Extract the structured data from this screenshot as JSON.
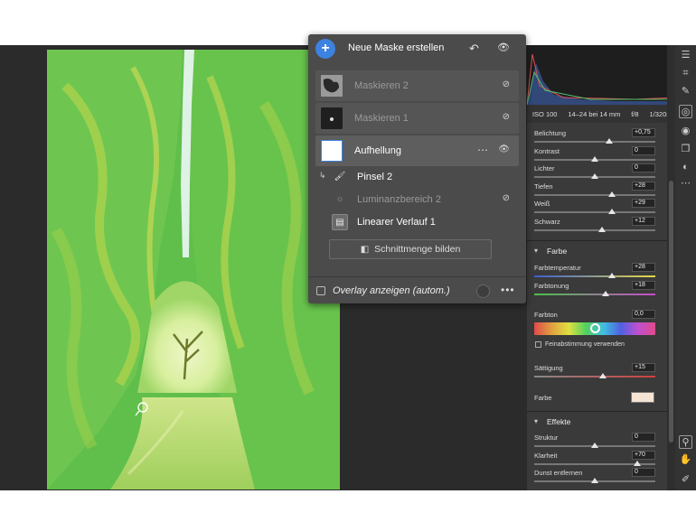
{
  "mask_panel": {
    "create_label": "Neue Maske erstellen",
    "masks": [
      {
        "label": "Maskieren 2",
        "hidden": true
      },
      {
        "label": "Maskieren 1",
        "hidden": true
      },
      {
        "label": "Aufhellung",
        "active": true
      }
    ],
    "components": [
      {
        "label": "Pinsel 2",
        "dimmed": false
      },
      {
        "label": "Luminanzbereich 2",
        "dimmed": true
      },
      {
        "label": "Linearer Verlauf 1",
        "dimmed": false
      }
    ],
    "intersect_label": "Schnittmenge bilden",
    "overlay_label": "Overlay anzeigen (autom.)"
  },
  "camera": {
    "iso": "ISO 100",
    "lens": "14–24 bei 14 mm",
    "aperture": "f/8",
    "shutter": "1/320s"
  },
  "light": [
    {
      "label": "Belichtung",
      "value": "+0,75",
      "pos": 0.62
    },
    {
      "label": "Kontrast",
      "value": "0",
      "pos": 0.5
    },
    {
      "label": "Lichter",
      "value": "0",
      "pos": 0.5
    },
    {
      "label": "Tiefen",
      "value": "+28",
      "pos": 0.64
    },
    {
      "label": "Weiß",
      "value": "+29",
      "pos": 0.64
    },
    {
      "label": "Schwarz",
      "value": "+12",
      "pos": 0.56
    }
  ],
  "color_section": {
    "title": "Farbe",
    "temperature": {
      "label": "Farbtemperatur",
      "value": "+28",
      "pos": 0.64
    },
    "tint": {
      "label": "Farbtonung",
      "value": "+18",
      "pos": 0.59
    },
    "hue": {
      "label": "Farbton",
      "value": "0,0"
    },
    "fine_tune_label": "Feinabstimmung verwenden",
    "saturation": {
      "label": "Sättigung",
      "value": "+15",
      "pos": 0.57
    },
    "swatch_label": "Farbe",
    "swatch_color": "#f5e3d3"
  },
  "effects_section": {
    "title": "Effekte",
    "items": [
      {
        "label": "Struktur",
        "value": "0",
        "pos": 0.5
      },
      {
        "label": "Klarheit",
        "value": "+70",
        "pos": 0.85
      },
      {
        "label": "Dunst entfernen",
        "value": "0",
        "pos": 0.5
      }
    ]
  },
  "colors": {
    "accent": "#3d82e0",
    "overlay_green": "#5fbf4a"
  }
}
